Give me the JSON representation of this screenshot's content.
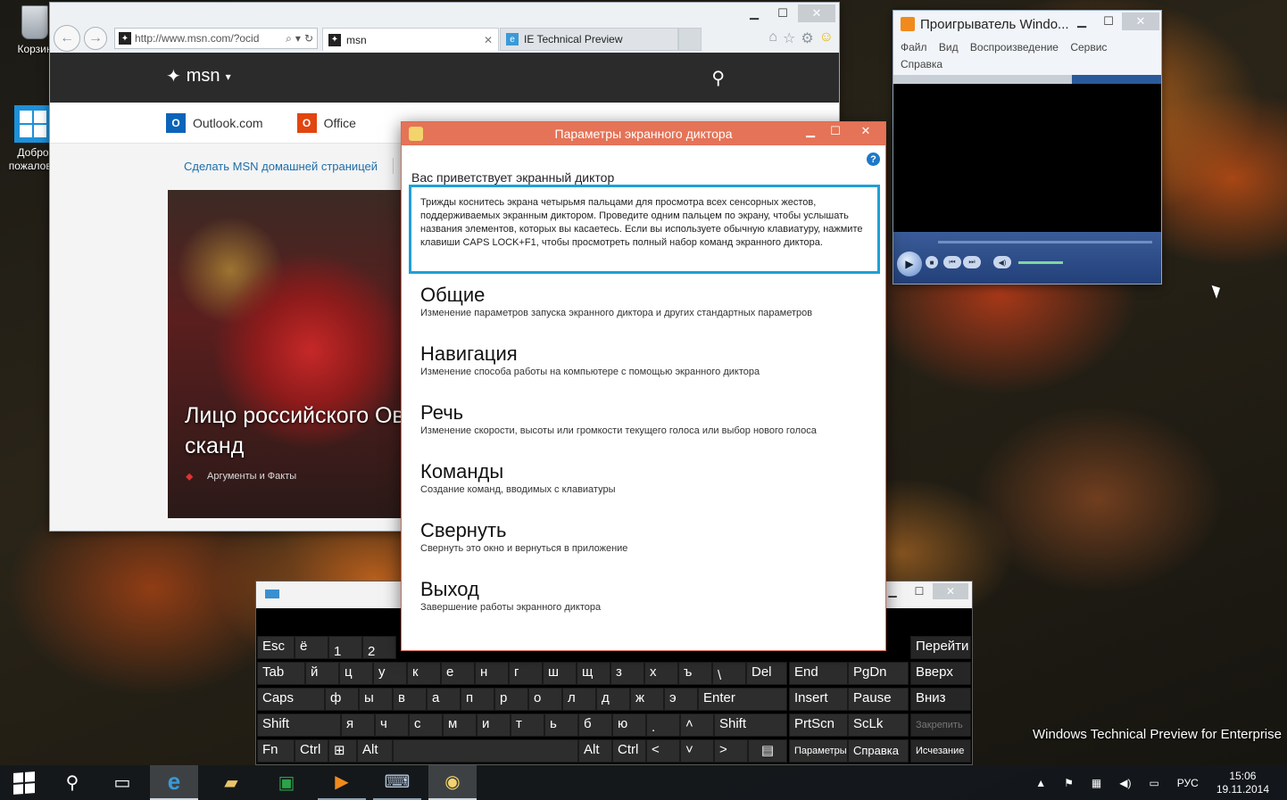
{
  "desktop": {
    "icons": [
      {
        "label": "Корзин"
      },
      {
        "label": "Добро пожалова"
      }
    ],
    "watermark": "Windows Technical Preview for Enterprise"
  },
  "ie": {
    "address_url": "http://www.msn.com/?ocid",
    "tabs": [
      {
        "label": "msn"
      },
      {
        "label": "IE Technical Preview"
      }
    ],
    "msn": {
      "logo_text": "msn",
      "links": [
        {
          "label": "Outlook.com",
          "badge": "O"
        },
        {
          "label": "Office",
          "badge": "O"
        }
      ],
      "make_home": "Сделать MSN домашней страницей",
      "hero_title": "Лицо российского Овечкина до сканд",
      "hero_source": "Аргументы и Факты"
    }
  },
  "media_player": {
    "title": "Проигрыватель Windo...",
    "menu": [
      "Файл",
      "Вид",
      "Воспроизведение",
      "Сервис",
      "Справка"
    ]
  },
  "narrator": {
    "title": "Параметры экранного диктора",
    "welcome": "Вас приветствует экранный диктор",
    "info": "Трижды коснитесь экрана четырьмя пальцами для просмотра всех сенсорных жестов, поддерживаемых экранным диктором. Проведите одним пальцем по экрану, чтобы услышать названия элементов, которых вы касаетесь. Если вы используете обычную клавиатуру, нажмите клавиши CAPS LOCK+F1, чтобы просмотреть полный набор команд экранного диктора.",
    "options": [
      {
        "title": "Общие",
        "desc": "Изменение параметров запуска экранного диктора и других стандартных параметров"
      },
      {
        "title": "Навигация",
        "desc": "Изменение способа работы на компьютере с помощью экранного диктора"
      },
      {
        "title": "Речь",
        "desc": "Изменение скорости, высоты или громкости текущего голоса или выбор нового голоса"
      },
      {
        "title": "Команды",
        "desc": "Создание команд, вводимых с клавиатуры"
      },
      {
        "title": "Свернуть",
        "desc": "Свернуть это окно и вернуться в приложение"
      },
      {
        "title": "Выход",
        "desc": "Завершение работы экранного диктора"
      }
    ]
  },
  "keyboard": {
    "keys": {
      "esc": "Esc",
      "yo": "ё",
      "one": "1",
      "two": "2",
      "tab": "Tab",
      "y": "й",
      "ts": "ц",
      "u": "у",
      "k": "к",
      "e": "е",
      "n": "н",
      "g": "г",
      "sh": "ш",
      "sch": "щ",
      "z": "з",
      "h": "х",
      "hard": "ъ",
      "bslash": "\\",
      "del": "Del",
      "caps": "Caps",
      "f": "ф",
      "yy": "ы",
      "v": "в",
      "a": "а",
      "p": "п",
      "r": "р",
      "o": "о",
      "l": "л",
      "d": "д",
      "zh": "ж",
      "ee": "э",
      "enter": "Enter",
      "shift_l": "Shift",
      "ya": "я",
      "ch": "ч",
      "s": "с",
      "m": "м",
      "i": "и",
      "t": "т",
      "soft": "ь",
      "b": "б",
      "yu": "ю",
      "dot": ".",
      "up": "˄",
      "shift_r": "Shift",
      "fn": "Fn",
      "ctrl_l": "Ctrl",
      "alt_l": "Alt",
      "alt_r": "Alt",
      "ctrl_r": "Ctrl",
      "left": "<",
      "down": "˅",
      "right": ">",
      "end": "End",
      "pgdn": "PgDn",
      "insert": "Insert",
      "pause": "Pause",
      "prtscn": "PrtScn",
      "scrlk": "ScLk",
      "options": "Параметры",
      "help": "Справка",
      "go": "Перейти",
      "pgup": "Вверх",
      "pgdown": "Вниз",
      "lock": "Закрепить",
      "fade": "Исчезание"
    }
  },
  "taskbar": {
    "language": "РУС",
    "time": "15:06",
    "date": "19.11.2014"
  },
  "colors": {
    "narrator_title": "#e57357",
    "narrator_focus": "#1fa0d6",
    "taskbar": "#14181c",
    "osk_background": "#000000"
  }
}
